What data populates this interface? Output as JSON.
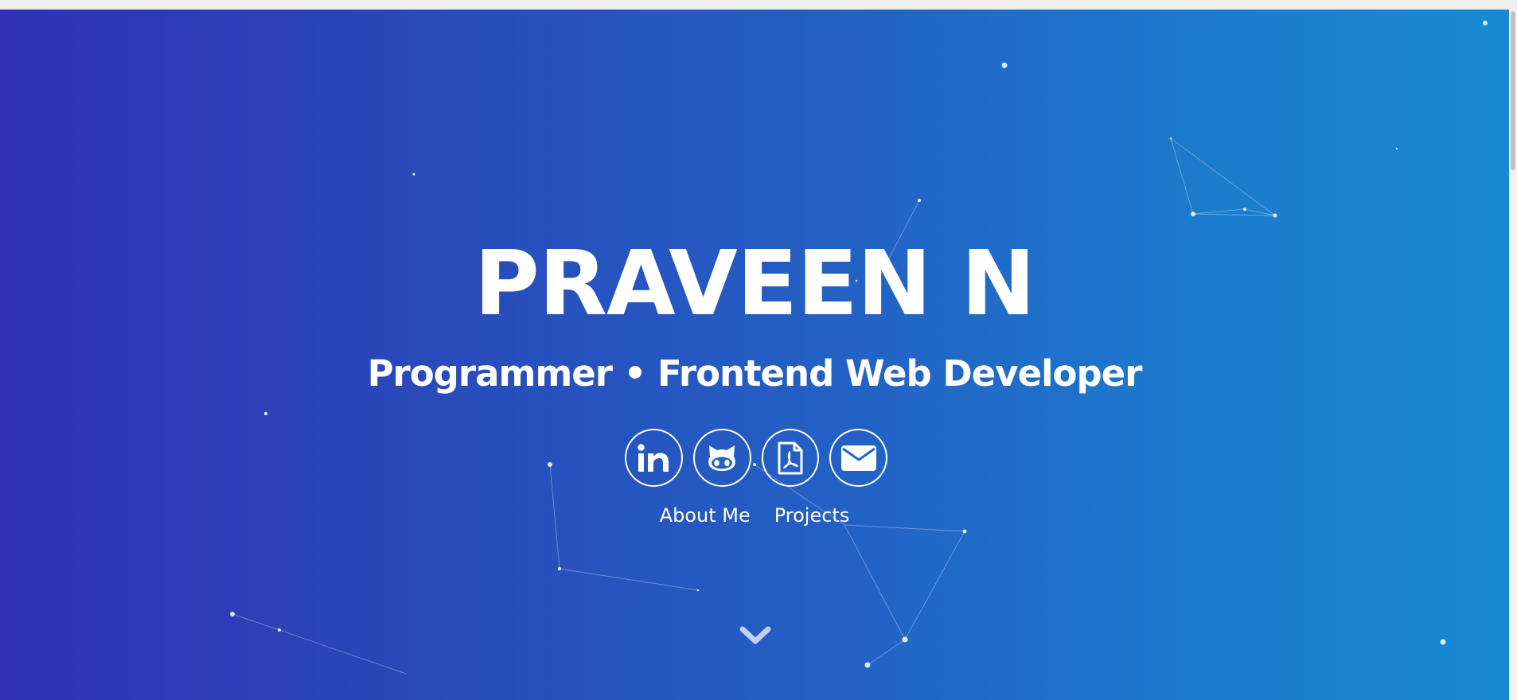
{
  "hero": {
    "name": "PRAVEEN N",
    "tagline": "Programmer • Frontend Web Developer",
    "gradient": [
      "#2f31b2",
      "#178ad2"
    ]
  },
  "socials": [
    {
      "name": "linkedin",
      "icon": "linkedin-icon"
    },
    {
      "name": "github",
      "icon": "github-icon"
    },
    {
      "name": "resume",
      "icon": "pdf-file-icon"
    },
    {
      "name": "email",
      "icon": "envelope-icon"
    }
  ],
  "nav": {
    "about_label": "About Me",
    "projects_label": "Projects"
  },
  "scroll_hint": {
    "icon": "chevron-down-icon"
  }
}
